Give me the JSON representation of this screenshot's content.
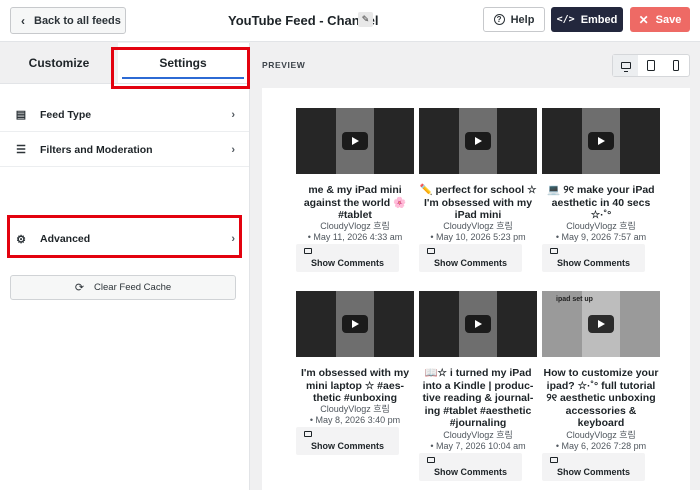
{
  "header": {
    "back_label": "Back to all feeds",
    "title": "YouTube Feed - Channel",
    "help_label": "Help",
    "embed_label": "Embed",
    "save_label": "Save"
  },
  "sidebar": {
    "tabs": [
      {
        "label": "Customize",
        "active": false
      },
      {
        "label": "Settings",
        "active": true
      }
    ],
    "items": [
      {
        "label": "Feed Type",
        "icon": "feed-type-icon"
      },
      {
        "label": "Filters and Moderation",
        "icon": "filters-icon"
      },
      {
        "label": "Advanced",
        "icon": "gear-icon"
      }
    ],
    "clear_cache_label": "Clear Feed Cache"
  },
  "preview": {
    "label": "PREVIEW",
    "devices": [
      "desktop",
      "tablet",
      "mobile"
    ],
    "active_device": "desktop",
    "videos": [
      {
        "title": "me & my iPad mini against the world 🌸 #tablet",
        "author": "CloudyVlogz 흐림",
        "date": "• May 11, 2026 4:33 am",
        "comments_label": "Show Comments"
      },
      {
        "title": "✏️ perfect for school ☆ I'm obsessed with my iPad mini",
        "author": "CloudyVlogz 흐림",
        "date": "• May 10, 2026 5:23 pm",
        "comments_label": "Show Comments"
      },
      {
        "title": "💻 ୨୧ make your iPad aesthetic in 40 secs ☆·˚°",
        "author": "CloudyVlogz 흐림",
        "date": "• May 9, 2026 7:57 am",
        "comments_label": "Show Comments"
      },
      {
        "title": "I'm obsessed with my mini laptop ☆ #aes- thetic #unboxing",
        "author": "CloudyVlogz 흐림",
        "date": "• May 8, 2026 3:40 pm",
        "comments_label": "Show Comments"
      },
      {
        "title": "📖☆ i turned my iPad into a Kindle | produc- tive reading & journal- ing #tablet #aesthetic #journaling",
        "author": "CloudyVlogz 흐림",
        "date": "• May 7, 2026 10:04 am",
        "comments_label": "Show Comments"
      },
      {
        "title": "How to customize your ipad? ☆·˚° full tutorial ୨୧ aesthetic unboxing accessories & keyboard",
        "author": "CloudyVlogz 흐림",
        "date": "• May 6, 2026 7:28 pm",
        "comments_label": "Show Comments",
        "thumb_text": "ipad set up"
      }
    ]
  },
  "colors": {
    "highlight": "#e3020f",
    "embed": "#23273d",
    "save": "#ee6a65",
    "tab_underline": "#2c6ad4"
  }
}
